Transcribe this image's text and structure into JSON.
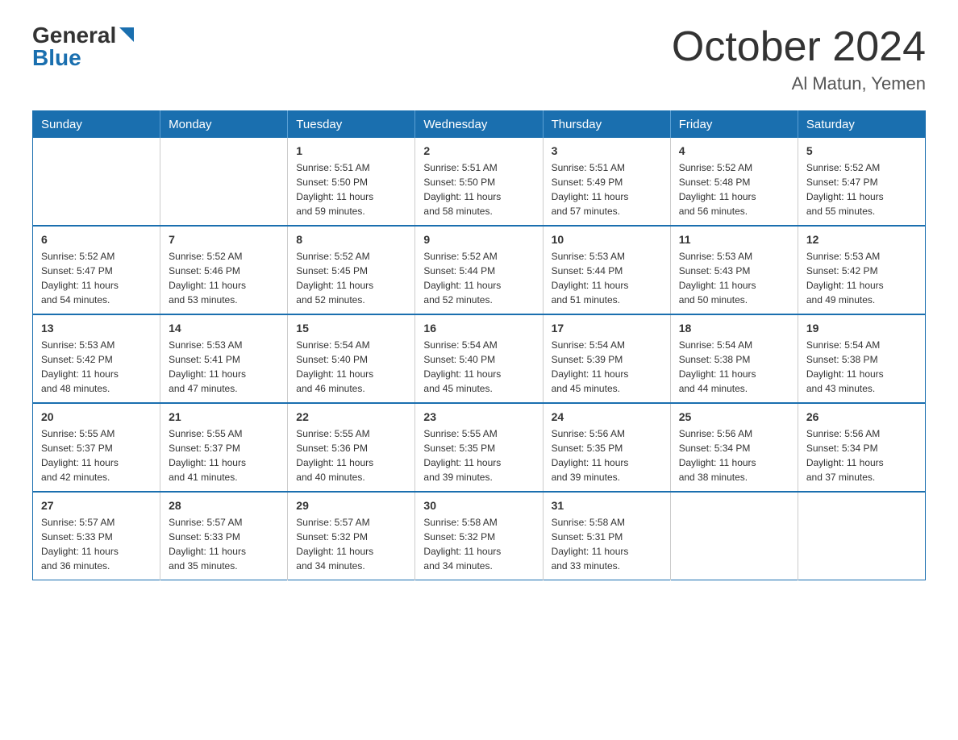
{
  "logo": {
    "general": "General",
    "blue": "Blue"
  },
  "header": {
    "month": "October 2024",
    "location": "Al Matun, Yemen"
  },
  "days_of_week": [
    "Sunday",
    "Monday",
    "Tuesday",
    "Wednesday",
    "Thursday",
    "Friday",
    "Saturday"
  ],
  "weeks": [
    [
      {
        "day": "",
        "info": ""
      },
      {
        "day": "",
        "info": ""
      },
      {
        "day": "1",
        "info": "Sunrise: 5:51 AM\nSunset: 5:50 PM\nDaylight: 11 hours\nand 59 minutes."
      },
      {
        "day": "2",
        "info": "Sunrise: 5:51 AM\nSunset: 5:50 PM\nDaylight: 11 hours\nand 58 minutes."
      },
      {
        "day": "3",
        "info": "Sunrise: 5:51 AM\nSunset: 5:49 PM\nDaylight: 11 hours\nand 57 minutes."
      },
      {
        "day": "4",
        "info": "Sunrise: 5:52 AM\nSunset: 5:48 PM\nDaylight: 11 hours\nand 56 minutes."
      },
      {
        "day": "5",
        "info": "Sunrise: 5:52 AM\nSunset: 5:47 PM\nDaylight: 11 hours\nand 55 minutes."
      }
    ],
    [
      {
        "day": "6",
        "info": "Sunrise: 5:52 AM\nSunset: 5:47 PM\nDaylight: 11 hours\nand 54 minutes."
      },
      {
        "day": "7",
        "info": "Sunrise: 5:52 AM\nSunset: 5:46 PM\nDaylight: 11 hours\nand 53 minutes."
      },
      {
        "day": "8",
        "info": "Sunrise: 5:52 AM\nSunset: 5:45 PM\nDaylight: 11 hours\nand 52 minutes."
      },
      {
        "day": "9",
        "info": "Sunrise: 5:52 AM\nSunset: 5:44 PM\nDaylight: 11 hours\nand 52 minutes."
      },
      {
        "day": "10",
        "info": "Sunrise: 5:53 AM\nSunset: 5:44 PM\nDaylight: 11 hours\nand 51 minutes."
      },
      {
        "day": "11",
        "info": "Sunrise: 5:53 AM\nSunset: 5:43 PM\nDaylight: 11 hours\nand 50 minutes."
      },
      {
        "day": "12",
        "info": "Sunrise: 5:53 AM\nSunset: 5:42 PM\nDaylight: 11 hours\nand 49 minutes."
      }
    ],
    [
      {
        "day": "13",
        "info": "Sunrise: 5:53 AM\nSunset: 5:42 PM\nDaylight: 11 hours\nand 48 minutes."
      },
      {
        "day": "14",
        "info": "Sunrise: 5:53 AM\nSunset: 5:41 PM\nDaylight: 11 hours\nand 47 minutes."
      },
      {
        "day": "15",
        "info": "Sunrise: 5:54 AM\nSunset: 5:40 PM\nDaylight: 11 hours\nand 46 minutes."
      },
      {
        "day": "16",
        "info": "Sunrise: 5:54 AM\nSunset: 5:40 PM\nDaylight: 11 hours\nand 45 minutes."
      },
      {
        "day": "17",
        "info": "Sunrise: 5:54 AM\nSunset: 5:39 PM\nDaylight: 11 hours\nand 45 minutes."
      },
      {
        "day": "18",
        "info": "Sunrise: 5:54 AM\nSunset: 5:38 PM\nDaylight: 11 hours\nand 44 minutes."
      },
      {
        "day": "19",
        "info": "Sunrise: 5:54 AM\nSunset: 5:38 PM\nDaylight: 11 hours\nand 43 minutes."
      }
    ],
    [
      {
        "day": "20",
        "info": "Sunrise: 5:55 AM\nSunset: 5:37 PM\nDaylight: 11 hours\nand 42 minutes."
      },
      {
        "day": "21",
        "info": "Sunrise: 5:55 AM\nSunset: 5:37 PM\nDaylight: 11 hours\nand 41 minutes."
      },
      {
        "day": "22",
        "info": "Sunrise: 5:55 AM\nSunset: 5:36 PM\nDaylight: 11 hours\nand 40 minutes."
      },
      {
        "day": "23",
        "info": "Sunrise: 5:55 AM\nSunset: 5:35 PM\nDaylight: 11 hours\nand 39 minutes."
      },
      {
        "day": "24",
        "info": "Sunrise: 5:56 AM\nSunset: 5:35 PM\nDaylight: 11 hours\nand 39 minutes."
      },
      {
        "day": "25",
        "info": "Sunrise: 5:56 AM\nSunset: 5:34 PM\nDaylight: 11 hours\nand 38 minutes."
      },
      {
        "day": "26",
        "info": "Sunrise: 5:56 AM\nSunset: 5:34 PM\nDaylight: 11 hours\nand 37 minutes."
      }
    ],
    [
      {
        "day": "27",
        "info": "Sunrise: 5:57 AM\nSunset: 5:33 PM\nDaylight: 11 hours\nand 36 minutes."
      },
      {
        "day": "28",
        "info": "Sunrise: 5:57 AM\nSunset: 5:33 PM\nDaylight: 11 hours\nand 35 minutes."
      },
      {
        "day": "29",
        "info": "Sunrise: 5:57 AM\nSunset: 5:32 PM\nDaylight: 11 hours\nand 34 minutes."
      },
      {
        "day": "30",
        "info": "Sunrise: 5:58 AM\nSunset: 5:32 PM\nDaylight: 11 hours\nand 34 minutes."
      },
      {
        "day": "31",
        "info": "Sunrise: 5:58 AM\nSunset: 5:31 PM\nDaylight: 11 hours\nand 33 minutes."
      },
      {
        "day": "",
        "info": ""
      },
      {
        "day": "",
        "info": ""
      }
    ]
  ]
}
